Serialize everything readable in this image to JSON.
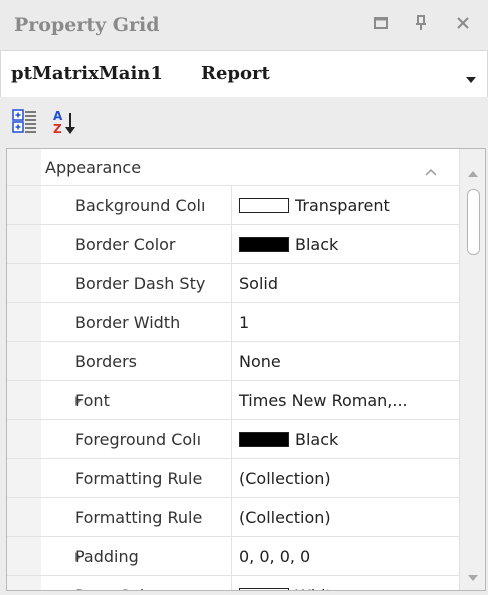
{
  "window": {
    "title": "Property Grid",
    "buttons": {
      "restore": "restore-icon",
      "pin": "pin-icon",
      "close": "close-icon"
    }
  },
  "selector": {
    "object_name": "ptMatrixMain1",
    "object_type": "Report"
  },
  "toolbar": {
    "categorized": "categorized-view-icon",
    "alphabetical": "alphabetical-sort-icon"
  },
  "colors": {
    "accent_blue": "#1e4fd6",
    "accent_red": "#d83020",
    "transparent_swatch": "#ffffff",
    "black_swatch": "#000000",
    "white_swatch": "#ffffff"
  },
  "category": {
    "label": "Appearance",
    "expanded": true
  },
  "properties": [
    {
      "name": "Background Colı",
      "value": "Transparent",
      "swatch": "#ffffff",
      "expandable": false
    },
    {
      "name": "Border Color",
      "value": "Black",
      "swatch": "#000000",
      "expandable": false
    },
    {
      "name": "Border Dash Sty",
      "value": "Solid",
      "swatch": null,
      "expandable": false
    },
    {
      "name": "Border Width",
      "value": "1",
      "swatch": null,
      "expandable": false
    },
    {
      "name": "Borders",
      "value": "None",
      "swatch": null,
      "expandable": false
    },
    {
      "name": "Font",
      "value": "Times New Roman,...",
      "swatch": null,
      "expandable": true
    },
    {
      "name": "Foreground Colı",
      "value": "Black",
      "swatch": "#000000",
      "expandable": false
    },
    {
      "name": "Formatting Rule",
      "value": "(Collection)",
      "swatch": null,
      "expandable": false
    },
    {
      "name": "Formatting Rule",
      "value": "(Collection)",
      "swatch": null,
      "expandable": false
    },
    {
      "name": "Padding",
      "value": "0, 0, 0, 0",
      "swatch": null,
      "expandable": true
    },
    {
      "name": "Page Color",
      "value": "White",
      "swatch": "#ffffff",
      "expandable": false
    }
  ]
}
